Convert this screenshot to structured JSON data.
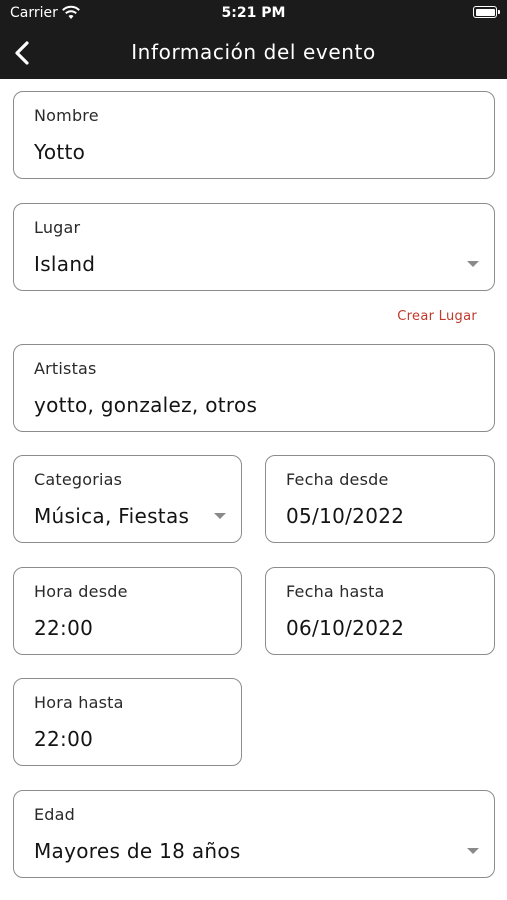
{
  "status_bar": {
    "carrier": "Carrier",
    "time": "5:21 PM"
  },
  "header": {
    "title": "Información del evento"
  },
  "form": {
    "nombre": {
      "label": "Nombre",
      "value": "Yotto"
    },
    "lugar": {
      "label": "Lugar",
      "value": "Island"
    },
    "crear_lugar": "Crear Lugar",
    "artistas": {
      "label": "Artistas",
      "value": "yotto, gonzalez, otros"
    },
    "categorias": {
      "label": "Categorias",
      "value": "Música, Fiestas"
    },
    "fecha_desde": {
      "label": "Fecha desde",
      "value": "05/10/2022"
    },
    "hora_desde": {
      "label": "Hora desde",
      "value": "22:00"
    },
    "fecha_hasta": {
      "label": "Fecha hasta",
      "value": "06/10/2022"
    },
    "hora_hasta": {
      "label": "Hora hasta",
      "value": "22:00"
    },
    "edad": {
      "label": "Edad",
      "value": "Mayores de 18 años"
    }
  },
  "colors": {
    "header_bg": "#1b1b1b",
    "link": "#c0392b",
    "border": "#8c8c8c"
  },
  "icons": {
    "back": "chevron-left-icon",
    "dropdown": "chevron-down-icon",
    "wifi": "wifi-icon",
    "battery": "battery-icon"
  }
}
